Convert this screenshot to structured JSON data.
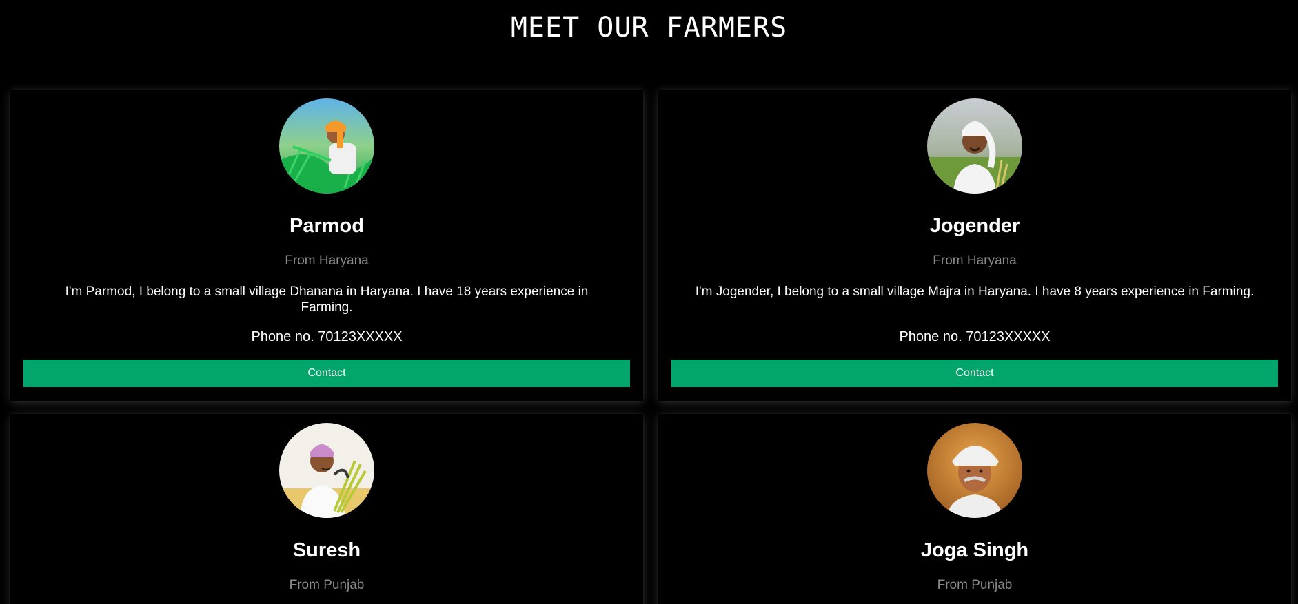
{
  "page": {
    "title": "MEET OUR FARMERS"
  },
  "colors": {
    "background": "#000000",
    "accent": "#02a66b",
    "muted_text": "#8a8a8a"
  },
  "farmers": [
    {
      "name": "Parmod",
      "origin": "From Haryana",
      "bio": "I'm Parmod, I belong to a small village Dhanana in Haryana. I have 18 years experience in Farming.",
      "phone": "Phone no. 70123XXXXX",
      "contact_label": "Contact",
      "avatar_icon": "farmer-photo-orange-turban"
    },
    {
      "name": "Jogender",
      "origin": "From Haryana",
      "bio": "I'm Jogender, I belong to a small village Majra in Haryana. I have 8 years experience in Farming.",
      "phone": "Phone no. 70123XXXXX",
      "contact_label": "Contact",
      "avatar_icon": "farmer-photo-white-turban"
    },
    {
      "name": "Suresh",
      "origin": "From Punjab",
      "avatar_icon": "farmer-photo-pink-turban"
    },
    {
      "name": "Joga Singh",
      "origin": "From Punjab",
      "avatar_icon": "farmer-photo-elderly-white-turban"
    }
  ]
}
